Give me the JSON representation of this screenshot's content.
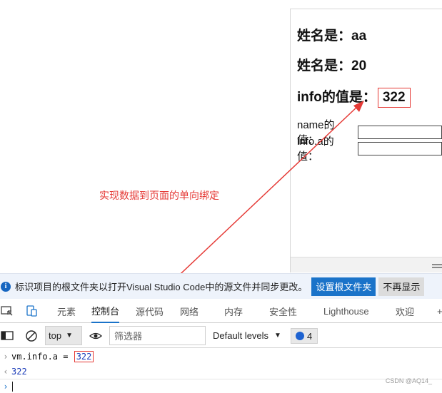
{
  "page": {
    "line1_label": "姓名是：",
    "line1_value": "aa",
    "line2_label": "姓名是：",
    "line2_value": "20",
    "line3_label": "info的值是：",
    "line3_value": "322",
    "name_label": "name的值：",
    "info_a_label": "info.a的值："
  },
  "annotation": {
    "text": "实现数据到页面的单向绑定",
    "color": "#e53935"
  },
  "notice": {
    "text": "标识项目的根文件夹以打开Visual Studio Code中的源文件并同步更改。",
    "primary_button": "设置根文件夹",
    "secondary_button": "不再显示"
  },
  "devtools": {
    "tabs": [
      "元素",
      "控制台",
      "源代码",
      "网络",
      "内存",
      "安全性",
      "Lighthouse",
      "欢迎"
    ],
    "active_tab": "控制台",
    "more_tabs": "+",
    "context": "top",
    "filter_placeholder": "筛选器",
    "levels": "Default levels",
    "issues_count": "4"
  },
  "console": {
    "command_prefix": "vm.info.a = ",
    "command_value": "322",
    "result": "322"
  },
  "watermark": "CSDN @AQ14_",
  "colors": {
    "accent": "#1a73c9",
    "annotation": "#e53935",
    "console_value": "#1a3bb8"
  }
}
